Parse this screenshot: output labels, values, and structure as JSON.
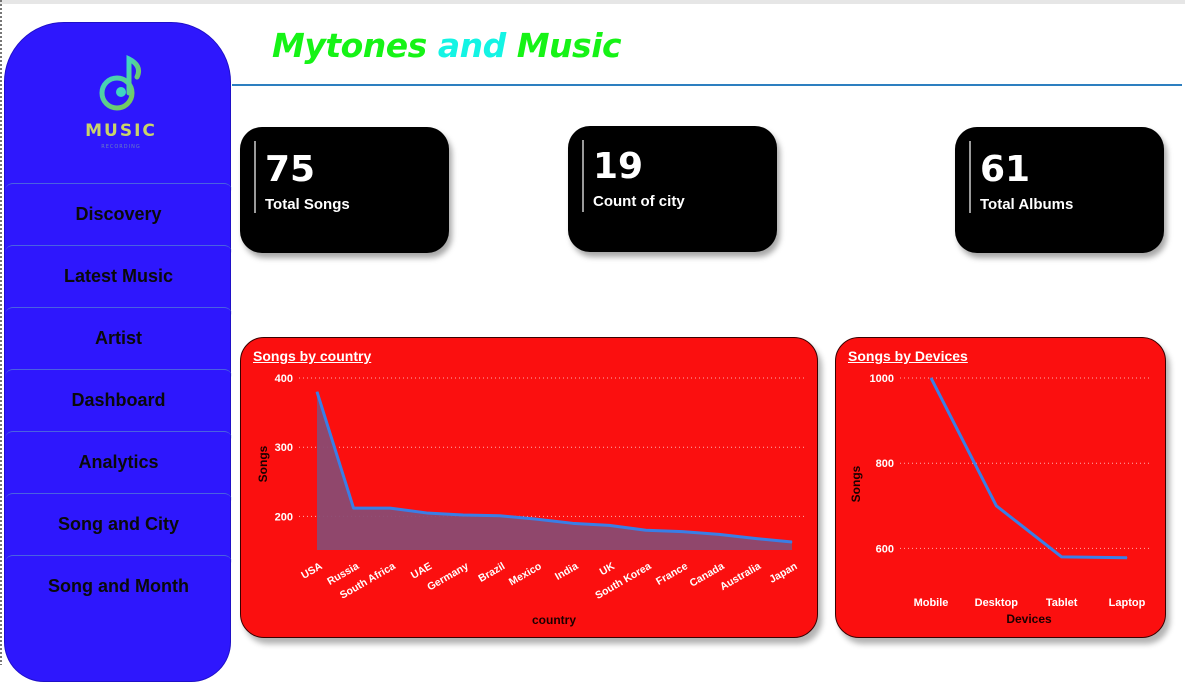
{
  "header": {
    "title_part1": "Mytones",
    "title_part2": "and",
    "title_part3": "Music"
  },
  "logo": {
    "text": "MUSIC",
    "subtext": "RECORDING"
  },
  "sidebar": {
    "items": [
      {
        "label": "Discovery"
      },
      {
        "label": "Latest Music"
      },
      {
        "label": "Artist"
      },
      {
        "label": "Dashboard"
      },
      {
        "label": "Analytics"
      },
      {
        "label": "Song and City"
      },
      {
        "label": "Song and Month"
      }
    ]
  },
  "kpis": [
    {
      "value": "75",
      "label": "Total Songs"
    },
    {
      "value": "19",
      "label": "Count of city"
    },
    {
      "value": "61",
      "label": "Total Albums"
    }
  ],
  "colors": {
    "sidebar": "#2e17fd",
    "panel": "#fb0f0f",
    "line": "#3a7ee6",
    "area": "#8a4b72",
    "title_green": "#16f316",
    "title_cyan": "#14f4e4"
  },
  "chart_data": [
    {
      "type": "area",
      "title": "Songs by country",
      "xlabel": "country",
      "ylabel": "Songs",
      "categories": [
        "USA",
        "Russia",
        "South Africa",
        "UAE",
        "Germany",
        "Brazil",
        "Mexico",
        "India",
        "UK",
        "South Korea",
        "France",
        "Canada",
        "Australia",
        "Japan"
      ],
      "values": [
        380,
        212,
        212,
        205,
        202,
        201,
        196,
        190,
        187,
        180,
        178,
        174,
        168,
        163
      ],
      "yticks": [
        200,
        300,
        400
      ],
      "ylim": [
        150,
        400
      ],
      "grid": true
    },
    {
      "type": "line",
      "title": "Songs by Devices",
      "xlabel": "Devices",
      "ylabel": "Songs",
      "categories": [
        "Mobile",
        "Desktop",
        "Tablet",
        "Laptop"
      ],
      "values": [
        1000,
        700,
        580,
        578
      ],
      "yticks": [
        600,
        800,
        1000
      ],
      "ylim": [
        500,
        1000
      ],
      "grid": true
    }
  ]
}
